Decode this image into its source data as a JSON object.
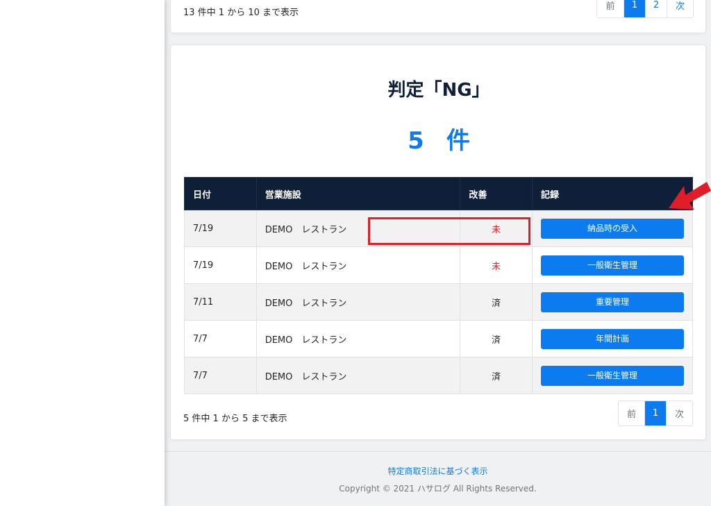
{
  "top_card": {
    "info": "13 件中 1 から 10 まで表示",
    "pagination": {
      "prev": "前",
      "pages": [
        "1",
        "2"
      ],
      "next": "次",
      "active": "1"
    }
  },
  "main_card": {
    "title": "判定「NG」",
    "count_number": "5",
    "count_unit": "件",
    "table": {
      "headers": {
        "date": "日付",
        "facility": "営業施設",
        "improvement": "改善",
        "record": "記録"
      },
      "rows": [
        {
          "date": "7/19",
          "facility": "DEMO　レストラン",
          "improvement": "未",
          "record": "納品時の受入"
        },
        {
          "date": "7/19",
          "facility": "DEMO　レストラン",
          "improvement": "未",
          "record": "一般衛生管理"
        },
        {
          "date": "7/11",
          "facility": "DEMO　レストラン",
          "improvement": "済",
          "record": "重要管理"
        },
        {
          "date": "7/7",
          "facility": "DEMO　レストラン",
          "improvement": "済",
          "record": "年間計画"
        },
        {
          "date": "7/7",
          "facility": "DEMO　レストラン",
          "improvement": "済",
          "record": "一般衛生管理"
        }
      ]
    },
    "info": "5 件中 1 から 5 まで表示",
    "pagination": {
      "prev": "前",
      "pages": [
        "1"
      ],
      "next": "次",
      "active": "1"
    }
  },
  "footer": {
    "link": "特定商取引法に基づく表示",
    "copyright": "Copyright © 2021 ハサログ All Rights Reserved."
  },
  "colors": {
    "accent": "#0d7bf0",
    "header_bg": "#0f1f3a",
    "status_pending": "#e02424",
    "annotation": "#e01e2a"
  },
  "annotation": {
    "arrow_icon": "red-arrow-icon",
    "target": "納品時の受入"
  }
}
